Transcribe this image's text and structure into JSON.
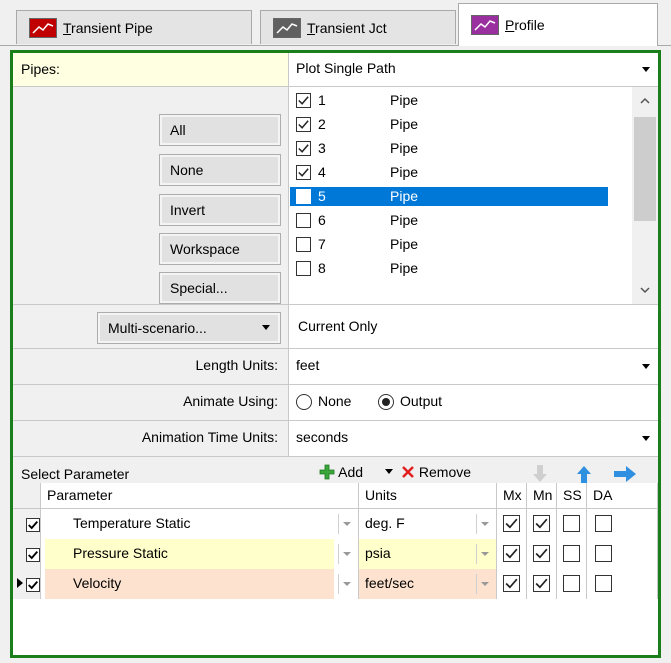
{
  "tabs": [
    {
      "label": "Transient Pipe",
      "icon": "line-chart-red-icon",
      "color": "#c00000"
    },
    {
      "label": "Transient Jct",
      "icon": "line-chart-gray-icon",
      "color": "#606060"
    },
    {
      "label": "Profile",
      "icon": "line-chart-purple-icon",
      "color": "#9a2fa0"
    }
  ],
  "pipes": {
    "label": "Pipes:",
    "mode": "Plot Single Path",
    "buttons": [
      "All",
      "None",
      "Invert",
      "Workspace",
      "Special..."
    ],
    "items": [
      {
        "num": "1",
        "name": "Pipe",
        "checked": true
      },
      {
        "num": "2",
        "name": "Pipe",
        "checked": true
      },
      {
        "num": "3",
        "name": "Pipe",
        "checked": true
      },
      {
        "num": "4",
        "name": "Pipe",
        "checked": true
      },
      {
        "num": "5",
        "name": "Pipe",
        "checked": true,
        "selected": true
      },
      {
        "num": "6",
        "name": "Pipe",
        "checked": false
      },
      {
        "num": "7",
        "name": "Pipe",
        "checked": false
      },
      {
        "num": "8",
        "name": "Pipe",
        "checked": false
      }
    ]
  },
  "scenario": {
    "button": "Multi-scenario...",
    "value": "Current Only"
  },
  "length_units": {
    "label": "Length Units:",
    "value": "feet"
  },
  "animate": {
    "label": "Animate Using:",
    "option_none": "None",
    "option_output": "Output",
    "selected": "Output"
  },
  "anim_time": {
    "label": "Animation Time Units:",
    "value": "seconds"
  },
  "select_param": {
    "label": "Select Parameter",
    "add": "Add",
    "remove": "Remove"
  },
  "param_table": {
    "headers": {
      "parameter": "Parameter",
      "units": "Units",
      "mx": "Mx",
      "mn": "Mn",
      "ss": "SS",
      "da": "DA"
    },
    "rows": [
      {
        "checked": true,
        "parameter": "Temperature Static",
        "units": "deg. F",
        "mx": true,
        "mn": true,
        "ss": false,
        "da": false,
        "bg": "#ffffff",
        "current": false
      },
      {
        "checked": true,
        "parameter": "Pressure Static",
        "units": "psia",
        "mx": true,
        "mn": true,
        "ss": false,
        "da": false,
        "bg": "#ffffcc",
        "current": false
      },
      {
        "checked": true,
        "parameter": "Velocity",
        "units": "feet/sec",
        "mx": true,
        "mn": true,
        "ss": false,
        "da": false,
        "bg": "#fde3cf",
        "current": true
      }
    ]
  }
}
